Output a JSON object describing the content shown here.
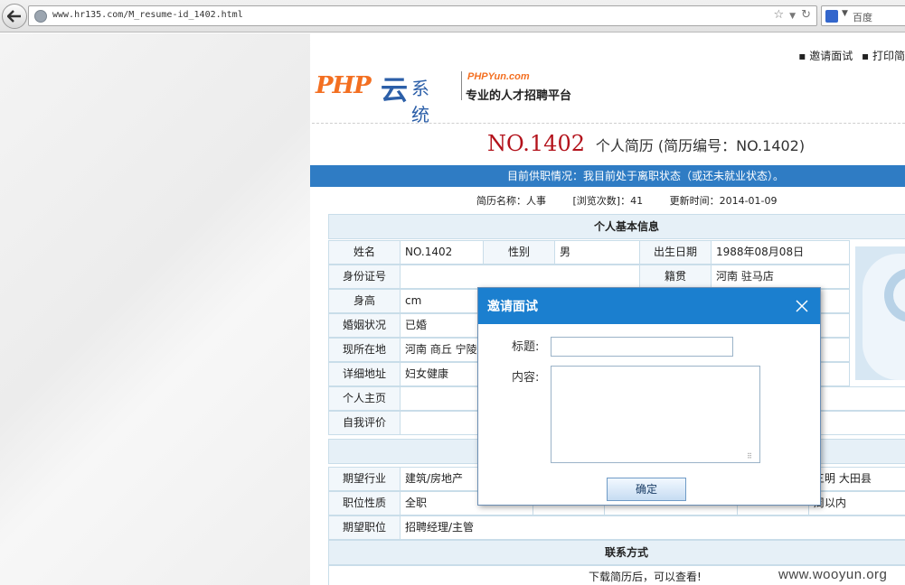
{
  "browser": {
    "url": "www.hr135.com/M_resume-id_1402.html",
    "search_engine_label": "百度"
  },
  "header": {
    "links": [
      "邀请面试",
      "打印简"
    ],
    "logo": {
      "php": "PHP",
      "cloud": "云",
      "system": "系统",
      "domain": "PHPYun.com",
      "slogan": "专业的人才招聘平台"
    }
  },
  "resume": {
    "number": "NO.1402",
    "subtitle": "个人简历 (简历编号：NO.1402)",
    "status_banner": "目前供职情况：我目前处于离职状态（或还未就业状态）。",
    "name_label": "简历名称：人事",
    "views_label": "[浏览次数]：41",
    "updated_label": "更新时间：2014-01-09"
  },
  "basic_info": {
    "title": "个人基本信息",
    "name_label": "姓名",
    "name_value": "NO.1402",
    "gender_label": "性别",
    "gender_value": "男",
    "birth_label": "出生日期",
    "birth_value": "1988年08月08日",
    "id_label": "身份证号",
    "id_value": "",
    "native_label": "籍贯",
    "native_value": "河南 驻马店",
    "height_label": "身高",
    "height_value": "cm",
    "marital_label": "婚姻状况",
    "marital_value": "已婚",
    "location_label": "现所在地",
    "location_value": "河南 商丘 宁陵",
    "address_label": "详细地址",
    "address_value": "妇女健康",
    "homepage_label": "个人主页",
    "homepage_value": "",
    "self_eval_label": "自我评价",
    "self_eval_value": ""
  },
  "intent": {
    "industry_label": "期望行业",
    "industry_value": "建筑/房地产",
    "type_label": "职位性质",
    "type_value": "全职",
    "position_label": "期望职位",
    "position_value": "招聘经理/主管",
    "city_right": "三明 大田县",
    "arrival_right": "周以内"
  },
  "contact": {
    "title": "联系方式",
    "note": "下载简历后，可以查看!"
  },
  "dialog": {
    "title": "邀请面试",
    "title_label": "标题:",
    "content_label": "内容:",
    "title_value": "",
    "content_value": "",
    "confirm_label": "确定"
  },
  "watermark": "www.wooyun.org",
  "colors": {
    "accent_blue": "#1b7fcf",
    "status_bar": "#2f7cc4",
    "resume_number": "#b3121b",
    "logo_orange": "#f36f21"
  }
}
